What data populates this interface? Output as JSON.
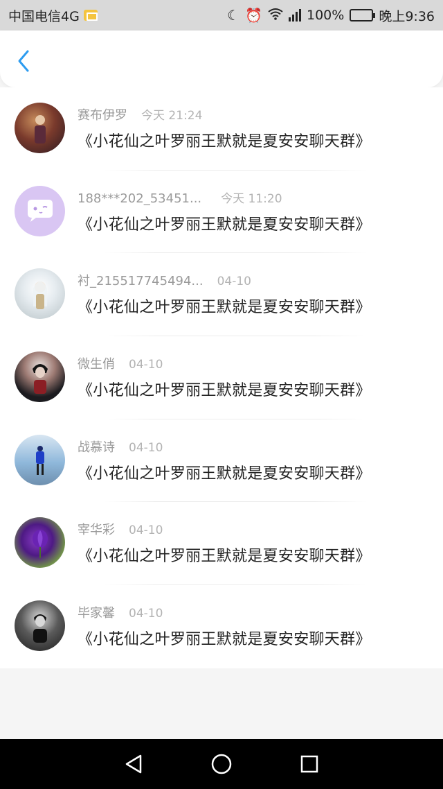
{
  "status_bar": {
    "carrier": "中国电信4G",
    "battery_percent": "100%",
    "time": "晚上9:36",
    "network_label": "4G"
  },
  "header": {
    "back_icon": "chevron-left-icon",
    "accent_color": "#2d9cf0"
  },
  "list": {
    "items": [
      {
        "name": "赛布伊罗",
        "time": "今天 21:24",
        "message": "《小花仙之叶罗丽王默就是夏安安聊天群》"
      },
      {
        "name": "188***202_53451...",
        "time": "今天 11:20",
        "message": "《小花仙之叶罗丽王默就是夏安安聊天群》"
      },
      {
        "name": "衬_215517745494...",
        "time": "04-10",
        "message": "《小花仙之叶罗丽王默就是夏安安聊天群》"
      },
      {
        "name": "微生俏",
        "time": "04-10",
        "message": "《小花仙之叶罗丽王默就是夏安安聊天群》"
      },
      {
        "name": "战慕诗",
        "time": "04-10",
        "message": "《小花仙之叶罗丽王默就是夏安安聊天群》"
      },
      {
        "name": "宰华彩",
        "time": "04-10",
        "message": "《小花仙之叶罗丽王默就是夏安安聊天群》"
      },
      {
        "name": "毕家馨",
        "time": "04-10",
        "message": "《小花仙之叶罗丽王默就是夏安安聊天群》"
      }
    ]
  },
  "nav_bar": {
    "back_icon": "triangle-back-icon",
    "home_icon": "circle-home-icon",
    "recents_icon": "square-recents-icon"
  }
}
